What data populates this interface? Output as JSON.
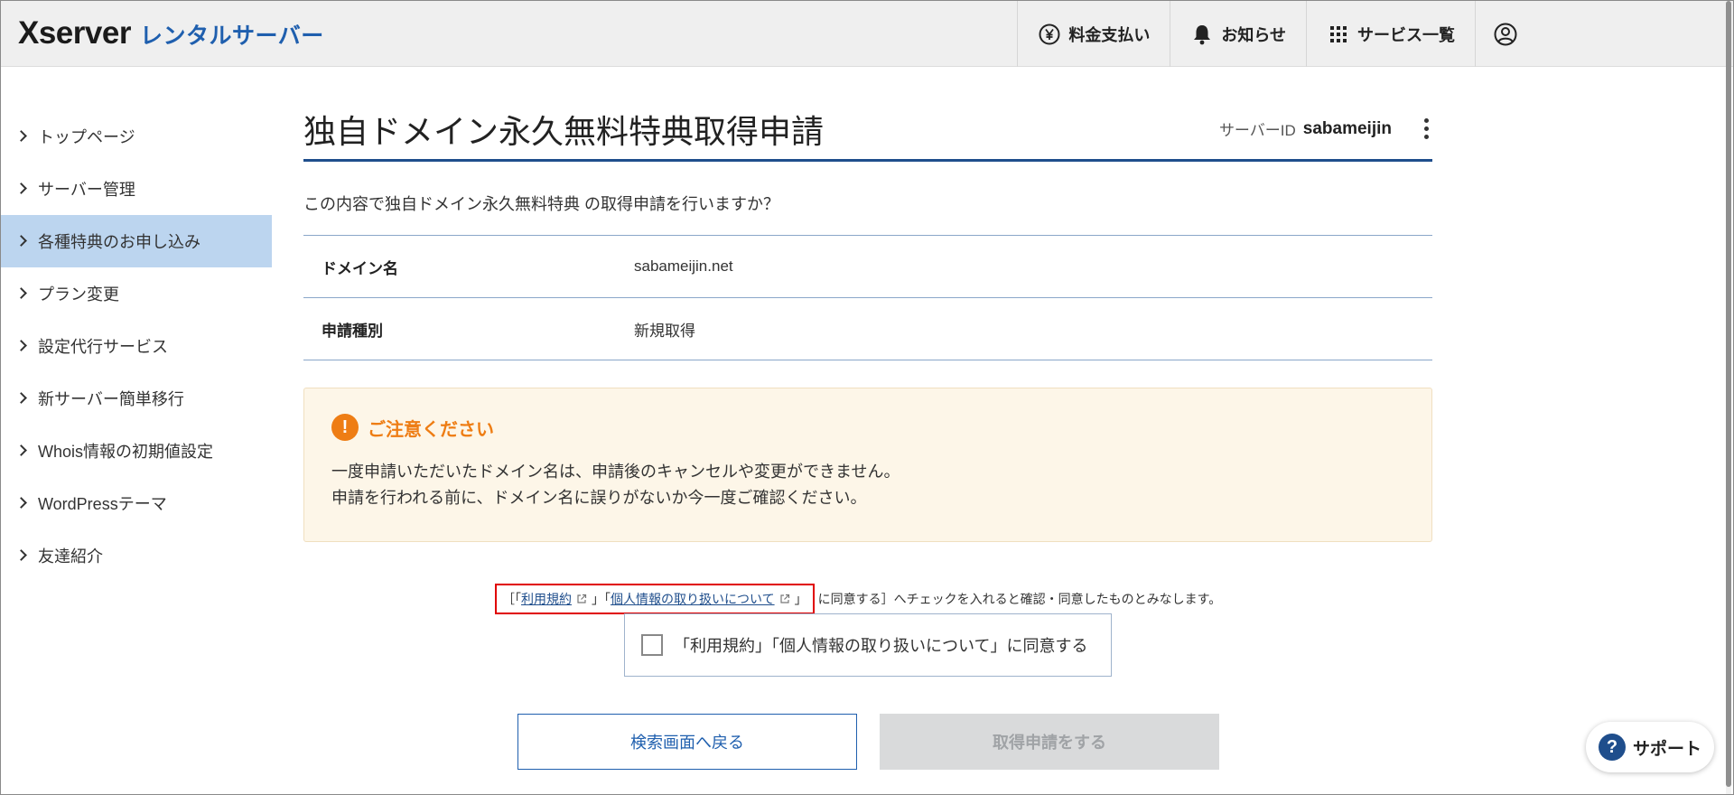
{
  "header": {
    "logo_main": "Xserver",
    "logo_sub": "レンタルサーバー",
    "nav": [
      {
        "label": "料金支払い",
        "icon": "yen-icon"
      },
      {
        "label": "お知らせ",
        "icon": "bell-icon"
      },
      {
        "label": "サービス一覧",
        "icon": "grid-icon"
      },
      {
        "label": "",
        "icon": "user-icon"
      }
    ]
  },
  "sidebar": {
    "items": [
      {
        "label": "トップページ"
      },
      {
        "label": "サーバー管理"
      },
      {
        "label": "各種特典のお申し込み",
        "active": true
      },
      {
        "label": "プラン変更"
      },
      {
        "label": "設定代行サービス"
      },
      {
        "label": "新サーバー簡単移行"
      },
      {
        "label": "Whois情報の初期値設定"
      },
      {
        "label": "WordPressテーマ"
      },
      {
        "label": "友達紹介"
      }
    ]
  },
  "main": {
    "title": "独自ドメイン永久無料特典取得申請",
    "server_id_label": "サーバーID",
    "server_id_value": "sabameijin",
    "lead": "この内容で独自ドメイン永久無料特典 の取得申請を行いますか？",
    "rows": [
      {
        "label": "ドメイン名",
        "value": "sabameijin.net"
      },
      {
        "label": "申請種別",
        "value": "新規取得"
      }
    ],
    "notice": {
      "title": "ご注意ください",
      "line1": "一度申請いただいたドメイン名は、申請後のキャンセルや変更ができません。",
      "line2": "申請を行われる前に、ドメイン名に誤りがないか今一度ご確認ください。"
    },
    "agree": {
      "bracket_open": "［「",
      "terms_link": "利用規約",
      "sep": "」「",
      "privacy_link": "個人情報の取り扱いについて",
      "bracket_close": "」",
      "suffix": "に同意する］へチェックを入れると確認・同意したものとみなします。",
      "checkbox_label": "「利用規約」「個人情報の取り扱いについて」に同意する",
      "checked": false
    },
    "buttons": {
      "back": "検索画面へ戻る",
      "submit": "取得申請をする"
    }
  },
  "support": {
    "label": "サポート"
  },
  "colors": {
    "accent": "#1f5fae",
    "active_bg": "#bcd5ef",
    "warning": "#ee7d14",
    "notice_bg": "#fdf6e8",
    "highlight": "#e00000"
  }
}
